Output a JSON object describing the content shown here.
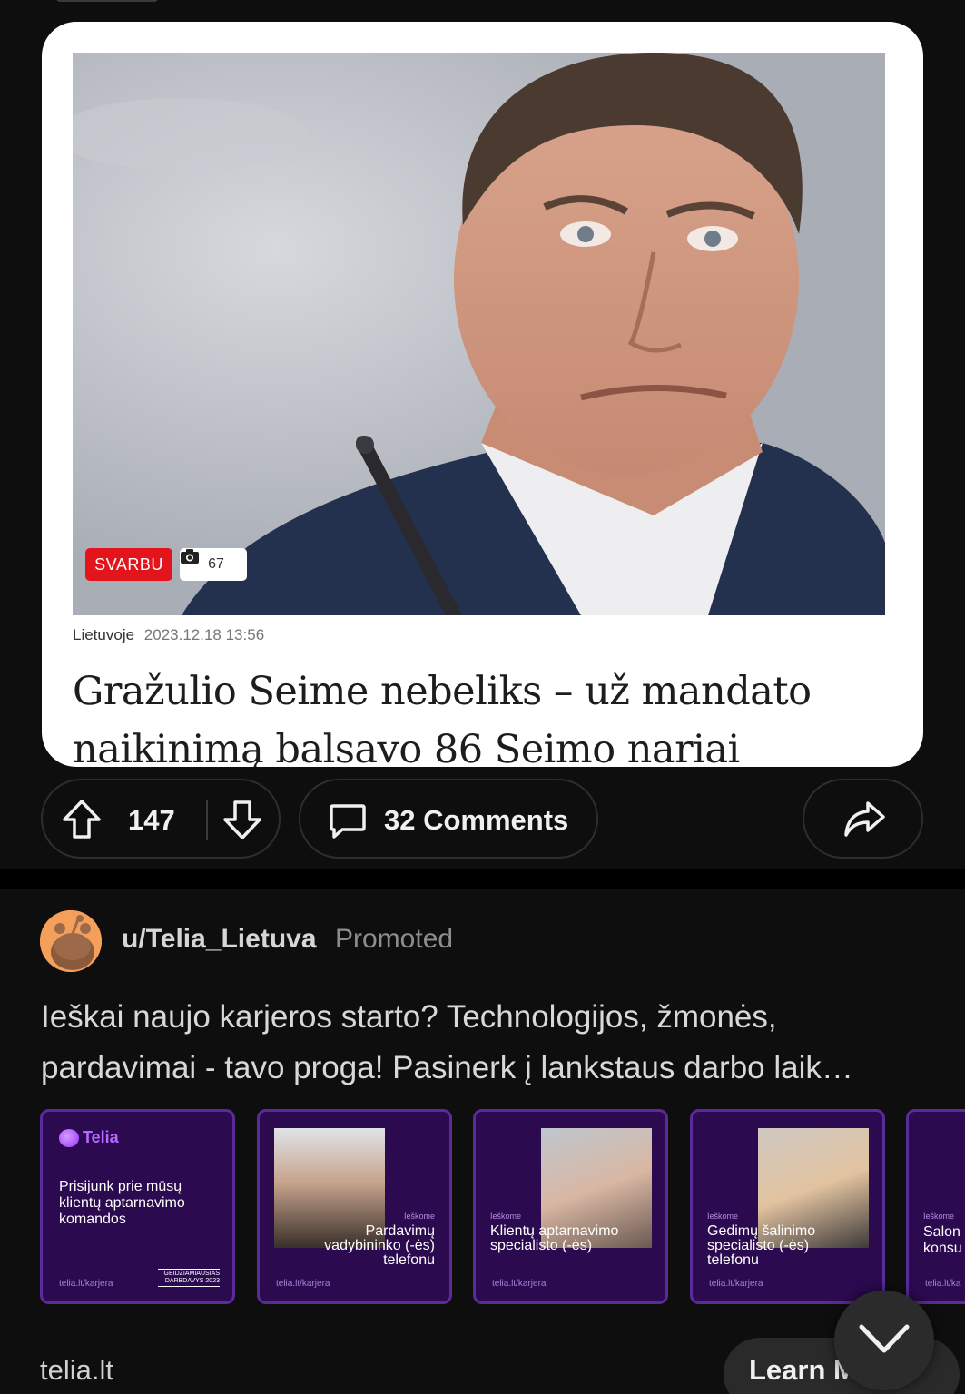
{
  "article": {
    "badge_important": "SVARBU",
    "photo_count": "67",
    "category": "Lietuvoje",
    "date": "2023.12.18 13:56",
    "headline": "Gražulio Seime nebeliks – už mandato naikinimą balsavo 86 Seimo nariai"
  },
  "actions": {
    "score": "147",
    "comments_label": "32 Comments"
  },
  "promoted_post": {
    "username": "u/Telia_Lietuva",
    "promoted_label": "Promoted",
    "text": "Ieškai naujo karjeros starto? Technologijos, žmonės, pardavimai - tavo proga! Pasinerk į lankstaus darbo laik…",
    "domain": "telia.lt",
    "cta_label": "Learn M",
    "tiles": [
      {
        "logo": "Telia",
        "title": "Prisijunk prie mūsų klientų aptarnavimo komandos",
        "url": "telia.lt/karjera",
        "award": "GEIDŽIAMIAUSIAS DARBDAVYS 2023"
      },
      {
        "seeking": "Ieškome",
        "title": "Pardavimų vadybininko (-ės) telefonu",
        "url": "telia.lt/karjera"
      },
      {
        "seeking": "Ieškome",
        "title": "Klientų aptarnavimo specialisto (-ės)",
        "url": "telia.lt/karjera"
      },
      {
        "seeking": "Ieškome",
        "title": "Gedimų šalinimo specialisto (-ės) telefonu",
        "url": "telia.lt/karjera"
      },
      {
        "seeking": "Ieškome",
        "title": "Salon konsu",
        "url": "telia.lt/ka"
      }
    ]
  },
  "colors": {
    "background": "#0e0e0e",
    "badge_red": "#e3141b",
    "telia_purple": "#2b0a50",
    "telia_accent": "#b468ff"
  },
  "icons": [
    "upvote-icon",
    "downvote-icon",
    "comment-icon",
    "share-icon",
    "camera-icon",
    "chevron-down-icon",
    "snoo-avatar-icon"
  ]
}
